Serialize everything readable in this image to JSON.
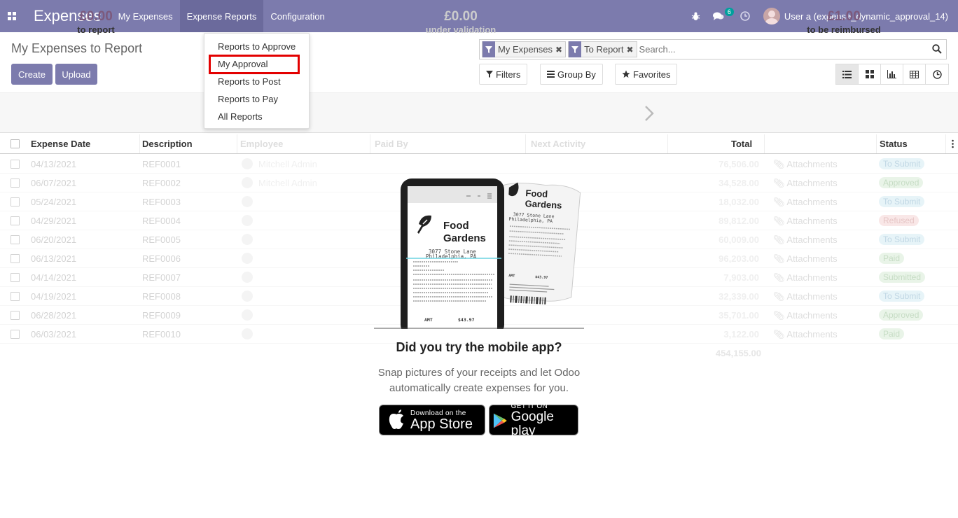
{
  "navbar": {
    "app_name": "Expenses",
    "menu": [
      "My Expenses",
      "Expense Reports",
      "Configuration"
    ],
    "chat_badge": "6",
    "user": "User a (expense_dynamic_approval_14)"
  },
  "page": {
    "title": "My Expenses to Report",
    "create_label": "Create",
    "upload_label": "Upload"
  },
  "search": {
    "facets": [
      "My Expenses",
      "To Report"
    ],
    "placeholder": "Search...",
    "filters_label": "Filters",
    "groupby_label": "Group By",
    "favorites_label": "Favorites"
  },
  "dashboard": {
    "to_report_value": "£0.00",
    "to_report_label": "to report",
    "validation_value": "£0.00",
    "validation_label": "under validation",
    "reimbursed_value": "£1.00",
    "reimbursed_label": "to be reimbursed"
  },
  "table": {
    "headers": [
      "Expense Date",
      "Description",
      "Employee",
      "Paid By",
      "Next Activity",
      "Total",
      "Status"
    ],
    "attachments_label": "Attachments",
    "rows": [
      {
        "date": "04/13/2021",
        "ref": "REF0001",
        "employee": "Mitchell Admin",
        "total": "76,506.00",
        "status": "To Submit"
      },
      {
        "date": "06/07/2021",
        "ref": "REF0002",
        "employee": "Mitchell Admin",
        "total": "34,528.00",
        "status": "Approved"
      },
      {
        "date": "05/24/2021",
        "ref": "REF0003",
        "employee": "",
        "total": "18,032.00",
        "status": "To Submit"
      },
      {
        "date": "04/29/2021",
        "ref": "REF0004",
        "employee": "",
        "total": "89,812.00",
        "status": "Refused"
      },
      {
        "date": "06/20/2021",
        "ref": "REF0005",
        "employee": "",
        "total": "60,009.00",
        "status": "To Submit"
      },
      {
        "date": "06/13/2021",
        "ref": "REF0006",
        "employee": "",
        "total": "96,203.00",
        "status": "Paid"
      },
      {
        "date": "04/14/2021",
        "ref": "REF0007",
        "employee": "",
        "total": "7,903.00",
        "status": "Submitted"
      },
      {
        "date": "04/19/2021",
        "ref": "REF0008",
        "employee": "",
        "total": "32,339.00",
        "status": "To Submit"
      },
      {
        "date": "06/28/2021",
        "ref": "REF0009",
        "employee": "",
        "total": "35,701.00",
        "status": "Approved"
      },
      {
        "date": "06/03/2021",
        "ref": "REF0010",
        "employee": "",
        "total": "3,122.00",
        "status": "Paid"
      }
    ],
    "sum_total": "454,155.00"
  },
  "dropdown": {
    "items": [
      "Reports to Approve",
      "My Approval",
      "Reports to Post",
      "Reports to Pay",
      "All Reports"
    ]
  },
  "help": {
    "receipt_brand_line1": "Food",
    "receipt_brand_line2": "Gardens",
    "receipt_address1": "3077 Stone Lane",
    "receipt_address2": "Philadelphia, PA",
    "receipt_amt_label": "AMT",
    "receipt_amt": "$43.97",
    "title": "Did you try the mobile app?",
    "text": "Snap pictures of your receipts and let Odoo automatically create expenses for you.",
    "appstore_small": "Download on the",
    "appstore_big": "App Store",
    "googleplay_small": "GET IT ON",
    "googleplay_big": "Google play"
  }
}
